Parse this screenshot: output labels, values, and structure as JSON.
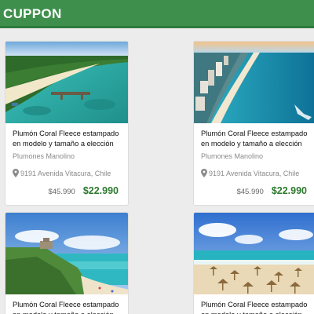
{
  "header": {
    "brand": "CUPPON",
    "color": "#3f8f4c"
  },
  "cards": [
    {
      "title": "Plumón Coral Fleece estampado en modelo y tamaño a elección",
      "merchant": "Plumones Manolino",
      "address": "9191 Avenida Vitacura, Chile",
      "old_price": "$45.990",
      "new_price": "$22.990",
      "image": "tropical-island-beach"
    },
    {
      "title": "Plumón Coral Fleece estampado en modelo y tamaño a elección",
      "merchant": "Plumones Manolino",
      "address": "9191 Avenida Vitacura, Chile",
      "old_price": "$45.990",
      "new_price": "$22.990",
      "image": "coastal-city-aerial"
    },
    {
      "title": "Plumón Coral Fleece estampado en modelo y tamaño a elección",
      "merchant": "",
      "address": "",
      "old_price": "",
      "new_price": "",
      "image": "cliff-ruins-beach"
    },
    {
      "title": "Plumón Coral Fleece estampado en modelo y tamaño a elección",
      "merchant": "",
      "address": "",
      "old_price": "",
      "new_price": "",
      "image": "beach-umbrellas"
    }
  ],
  "colors": {
    "price_new": "#2d7a2f",
    "muted": "#8a8a8a"
  }
}
